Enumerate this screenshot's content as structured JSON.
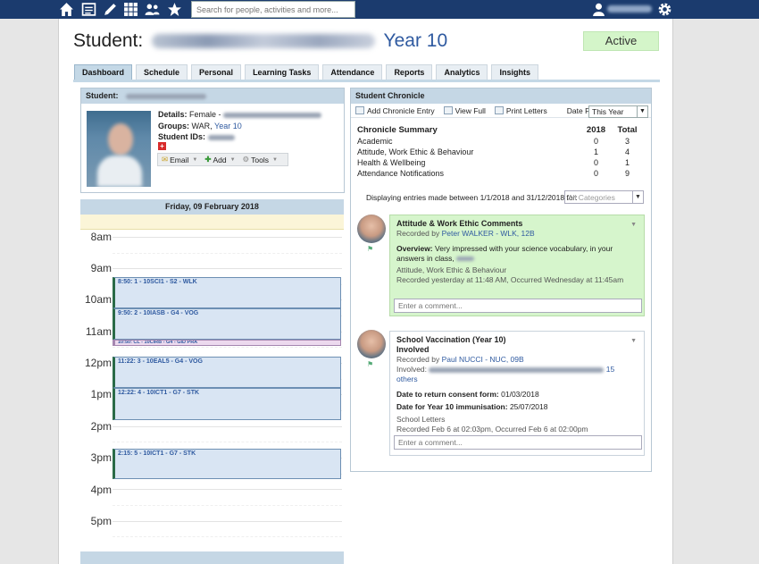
{
  "topbar": {
    "icons": [
      "home-icon",
      "gradebook-icon",
      "pencil-icon",
      "grid-icon",
      "people-icon",
      "star-icon",
      "user-icon",
      "gear-icon"
    ],
    "search_placeholder": "Search for people, activities and more..."
  },
  "header": {
    "prefix": "Student:",
    "year": "Year 10",
    "status": "Active"
  },
  "tabs": [
    "Dashboard",
    "Schedule",
    "Personal",
    "Learning Tasks",
    "Attendance",
    "Reports",
    "Analytics",
    "Insights"
  ],
  "student_panel": {
    "heading": "Student:",
    "details_label": "Details:",
    "details_value": "Female -",
    "groups_label": "Groups:",
    "groups_value": "WAR,",
    "groups_link": "Year 10",
    "ids_label": "Student IDs:",
    "actions": [
      "Email",
      "Add",
      "Tools"
    ]
  },
  "calendar": {
    "date": "Friday, 09 February 2018",
    "hours": [
      "8am",
      "9am",
      "10am",
      "11am",
      "12pm",
      "1pm",
      "2pm",
      "3pm",
      "4pm",
      "5pm"
    ],
    "events": [
      {
        "label": "8:50: 1 - 10SCI1 - S2 - WLK",
        "pink": false
      },
      {
        "label": "9:50: 2 - 10IASB - G4 - VOG",
        "pink": false
      },
      {
        "label": "10:50: CL - 10CIRB - G4 - GID PRA",
        "pink": true
      },
      {
        "label": "11:22: 3 - 10EAL5 - G4 - VOG",
        "pink": false
      },
      {
        "label": "12:22: 4 - 10ICT1 - G7 - STK",
        "pink": false
      },
      {
        "label": "2:15: 5 - 10ICT1 - G7 - STK",
        "pink": false
      }
    ]
  },
  "chronicle": {
    "heading": "Student Chronicle",
    "toolbar": {
      "add": "Add Chronicle Entry",
      "view": "View Full",
      "print": "Print Letters",
      "filter_label": "Date Filter:",
      "filter_value": "This Year"
    },
    "summary": {
      "title": "Chronicle Summary",
      "col1": "2018",
      "col2": "Total",
      "rows": [
        {
          "label": "Academic",
          "y": "0",
          "t": "3"
        },
        {
          "label": "Attitude, Work Ethic & Behaviour",
          "y": "1",
          "t": "4"
        },
        {
          "label": "Health & Wellbeing",
          "y": "0",
          "t": "1"
        },
        {
          "label": "Attendance Notifications",
          "y": "0",
          "t": "9"
        }
      ]
    },
    "entries_text": "Displaying entries made between 1/1/2018 and 31/12/2018 for:",
    "category_placeholder": "All Categories",
    "entry1": {
      "title": "Attitude & Work Ethic Comments",
      "recorded_by": "Recorded by",
      "author": "Peter WALKER - WLK, 12B",
      "overview_label": "Overview:",
      "overview": "Very impressed with your science vocabulary, in your answers in class,",
      "category": "Attitude, Work Ethic & Behaviour",
      "when": "Recorded yesterday at 11:48 AM, Occurred Wednesday at 11:45am",
      "comment_placeholder": "Enter a comment..."
    },
    "entry2": {
      "title": "School Vaccination (Year 10)",
      "subtitle": "Involved",
      "recorded_by": "Recorded by",
      "author": "Paul NUCCI - NUC, 09B",
      "involved_label": "Involved:",
      "others": "15 others",
      "return_label": "Date to return consent form:",
      "return_value": "01/03/2018",
      "immun_label": "Date for Year 10 immunisation:",
      "immun_value": "25/07/2018",
      "category": "School Letters",
      "when": "Recorded Feb 6 at 02:03pm, Occurred Feb 6 at 02:00pm",
      "comment_placeholder": "Enter a comment..."
    }
  }
}
